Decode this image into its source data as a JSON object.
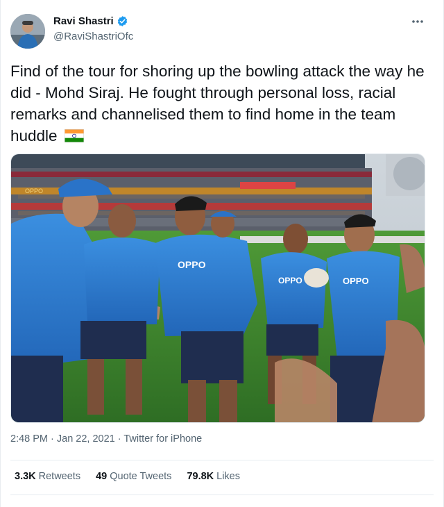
{
  "author": {
    "display_name": "Ravi Shastri",
    "handle": "@RaviShastriOfc",
    "verified": true
  },
  "tweet": {
    "text": "Find of the tour for shoring up the bowling attack the way he did - Mohd Siraj. He fought through personal loss, racial remarks and channelised them to find home in the team huddle",
    "emoji": "flag-india-icon",
    "photo_banners": [
      "OPPO",
      "OPPO",
      "OPPO",
      "OPPO"
    ]
  },
  "meta": {
    "time": "2:48 PM",
    "separator1": " · ",
    "date": "Jan 22, 2021",
    "separator2": " · ",
    "source": "Twitter for iPhone"
  },
  "stats": {
    "retweets_count": "3.3K",
    "retweets_label": "Retweets",
    "quotes_count": "49",
    "quotes_label": "Quote Tweets",
    "likes_count": "79.8K",
    "likes_label": "Likes"
  },
  "colors": {
    "verified": "#1d9bf0",
    "jersey": "#2f7fd0",
    "field": "#3f8a2e"
  }
}
